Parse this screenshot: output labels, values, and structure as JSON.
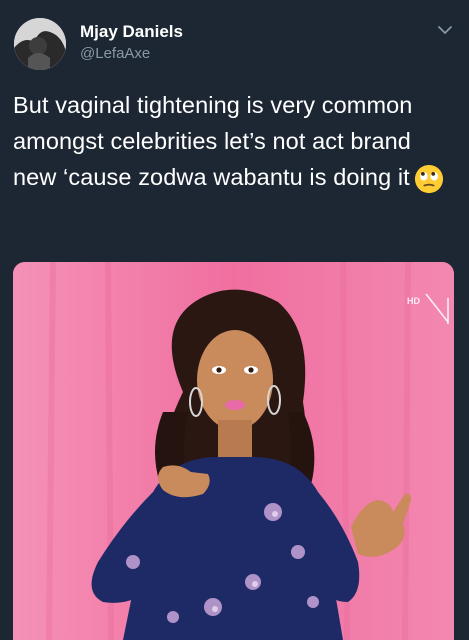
{
  "user": {
    "display_name": "Mjay Daniels",
    "handle": "@LefaAxe"
  },
  "tweet": {
    "text": "But vaginal tightening is very common amongst celebrities let’s not act brand new ‘cause zodwa wabantu is doing it",
    "emoji": "face-with-rolling-eyes"
  },
  "media": {
    "badge": "HD"
  },
  "icons": {
    "menu": "chevron-down-icon"
  },
  "colors": {
    "background": "#1c2733",
    "handle": "#8899a6",
    "media_bg": "#f06fa0",
    "dress": "#1e2a66"
  }
}
